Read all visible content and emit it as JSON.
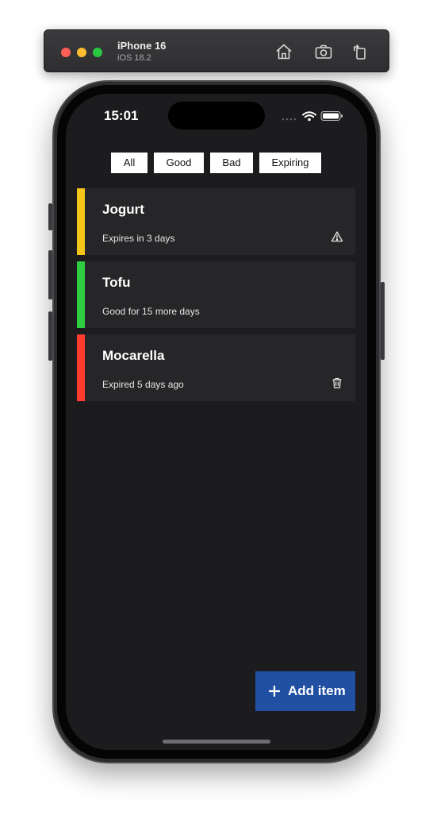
{
  "simulator": {
    "device_name": "iPhone 16",
    "os_version": "iOS 18.2",
    "tools": [
      "home-icon",
      "screenshot-icon",
      "rotate-icon"
    ]
  },
  "status_bar": {
    "time": "15:01"
  },
  "filters": [
    {
      "label": "All"
    },
    {
      "label": "Good"
    },
    {
      "label": "Bad"
    },
    {
      "label": "Expiring"
    }
  ],
  "items": [
    {
      "name": "Jogurt",
      "status": "Expires in 3 days",
      "color": "#f5c518",
      "icon": "warning-icon"
    },
    {
      "name": "Tofu",
      "status": "Good for 15 more days",
      "color": "#2ecc40",
      "icon": ""
    },
    {
      "name": "Mocarella",
      "status": "Expired 5 days ago",
      "color": "#ff3b30",
      "icon": "trash-icon"
    }
  ],
  "add_button": {
    "label": "Add item",
    "color": "#2150a3"
  }
}
